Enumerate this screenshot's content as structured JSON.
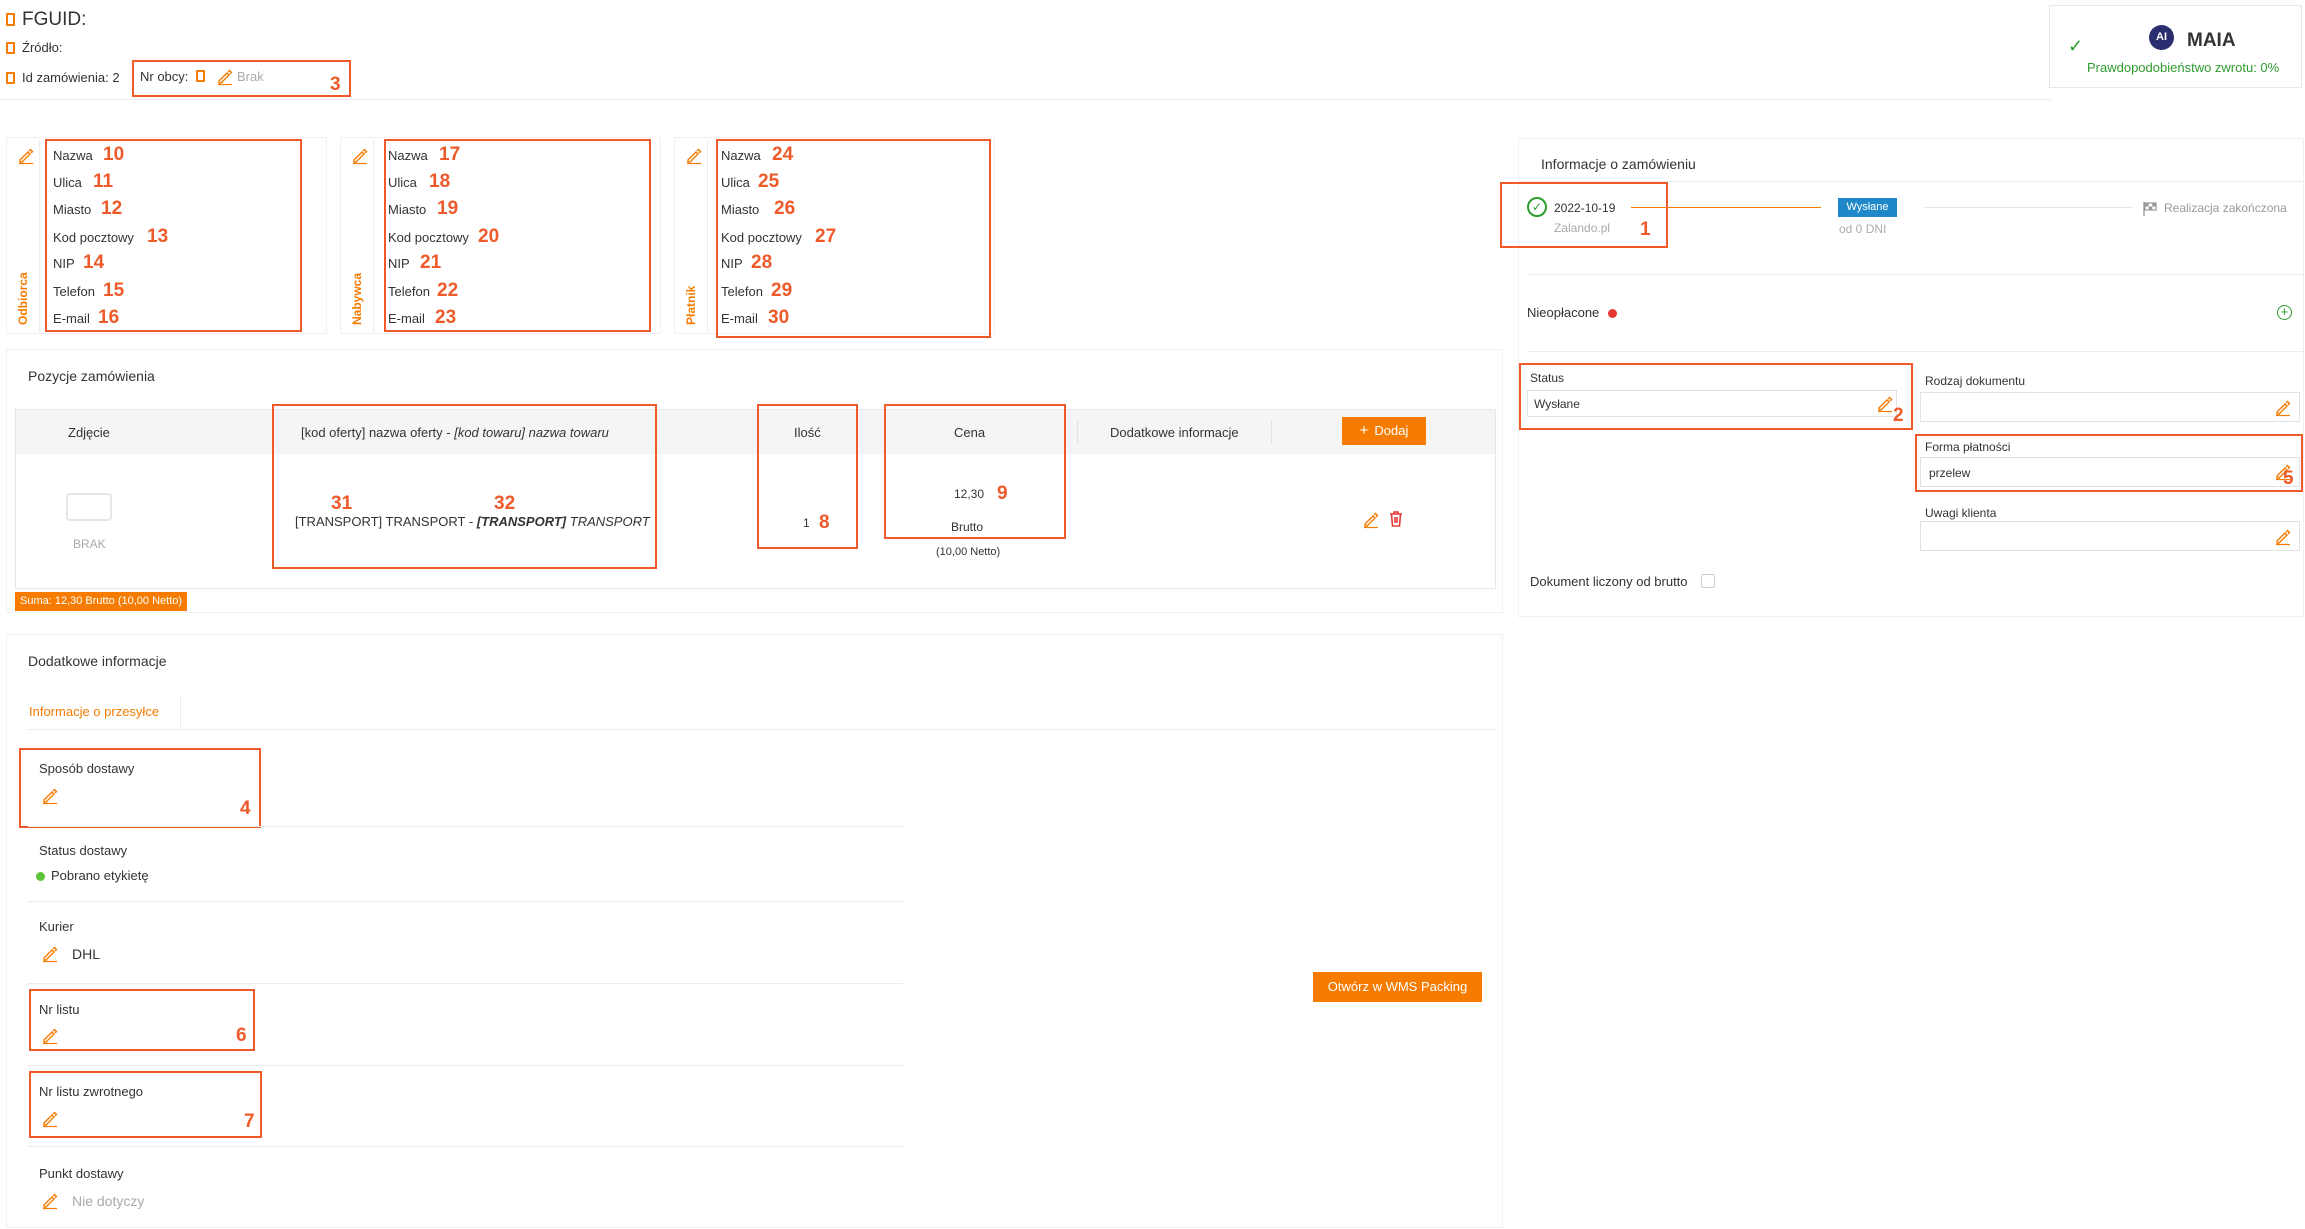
{
  "header": {
    "fguid_label": "FGUID:",
    "source_label": "Źródło:",
    "order_id_label": "Id zamówienia: 2",
    "foreign_no_label": "Nr obcy:",
    "foreign_no_value": "Brak",
    "num_3": "3"
  },
  "maia": {
    "name": "MAIA",
    "logo_text": "AI",
    "return_probability": "Prawdopodobieństwo zwrotu: 0%"
  },
  "contacts": [
    {
      "side_label": "Odbiorca",
      "fields": [
        {
          "label": "Nazwa",
          "num": "10"
        },
        {
          "label": "Ulica",
          "num": "11"
        },
        {
          "label": "Miasto",
          "num": "12"
        },
        {
          "label": "Kod pocztowy",
          "num": "13"
        },
        {
          "label": "NIP",
          "num": "14"
        },
        {
          "label": "Telefon",
          "num": "15"
        },
        {
          "label": "E-mail",
          "num": "16"
        }
      ]
    },
    {
      "side_label": "Nabywca",
      "fields": [
        {
          "label": "Nazwa",
          "num": "17"
        },
        {
          "label": "Ulica",
          "num": "18"
        },
        {
          "label": "Miasto",
          "num": "19"
        },
        {
          "label": "Kod pocztowy",
          "num": "20"
        },
        {
          "label": "NIP",
          "num": "21"
        },
        {
          "label": "Telefon",
          "num": "22"
        },
        {
          "label": "E-mail",
          "num": "23"
        }
      ]
    },
    {
      "side_label": "Płatnik",
      "fields": [
        {
          "label": "Nazwa",
          "num": "24"
        },
        {
          "label": "Ulica",
          "num": "25"
        },
        {
          "label": "Miasto",
          "num": "26"
        },
        {
          "label": "Kod pocztowy",
          "num": "27"
        },
        {
          "label": "NIP",
          "num": "28"
        },
        {
          "label": "Telefon",
          "num": "29"
        },
        {
          "label": "E-mail",
          "num": "30"
        }
      ]
    }
  ],
  "positions": {
    "title": "Pozycje zamówienia",
    "columns": {
      "photo": "Zdjęcie",
      "offer_code": "[kod oferty]",
      "offer_name": "nazwa oferty -",
      "product_code": "[kod towaru]",
      "product_name": "nazwa towaru",
      "qty": "Ilość",
      "price": "Cena",
      "extra": "Dodatkowe informacje",
      "add": "Dodaj"
    },
    "row": {
      "photo_text": "BRAK",
      "offer": "[TRANSPORT] TRANSPORT -",
      "product": "[TRANSPORT]",
      "product_tail": "TRANSPORT",
      "qty": "1",
      "price": "12,30",
      "price_type": "Brutto",
      "netto": "(10,00 Netto)",
      "num_31": "31",
      "num_32": "32",
      "num_8": "8",
      "num_9": "9"
    },
    "sum": "Suma: 12,30 Brutto (10,00 Netto)"
  },
  "extra_info": {
    "title": "Dodatkowe informacje",
    "tab": "Informacje o przesyłce",
    "delivery_method": {
      "label": "Sposób dostawy",
      "num": "4"
    },
    "delivery_status": {
      "label": "Status dostawy",
      "value": "Pobrano etykietę"
    },
    "courier": {
      "label": "Kurier",
      "value": "DHL"
    },
    "tracking": {
      "label": "Nr listu",
      "num": "6"
    },
    "return_tracking": {
      "label": "Nr listu zwrotnego",
      "num": "7"
    },
    "pickup": {
      "label": "Punkt dostawy",
      "value": "Nie dotyczy"
    },
    "wms_button": "Otwórz w WMS Packing"
  },
  "order_info": {
    "title": "Informacje o zamówieniu",
    "date": "2022-10-19",
    "shop": "Zalando.pl",
    "num_1": "1",
    "status_badge": "Wysłane",
    "days": "od 0 DNI",
    "finish": "Realizacja zakończona",
    "unpaid": "Nieopłacone",
    "status_label": "Status",
    "status_value": "Wysłane",
    "num_2": "2",
    "doc_type_label": "Rodzaj dokumentu",
    "payment_label": "Forma płatności",
    "payment_value": "przelew",
    "num_5": "5",
    "remarks_label": "Uwagi klienta",
    "gross_label": "Dokument liczony od brutto"
  },
  "colors": {
    "accent": "#f57c00",
    "highlight": "#ee5a2a",
    "badge_blue": "#1e88c8",
    "success": "#2e9b2e",
    "danger": "#e53935"
  }
}
